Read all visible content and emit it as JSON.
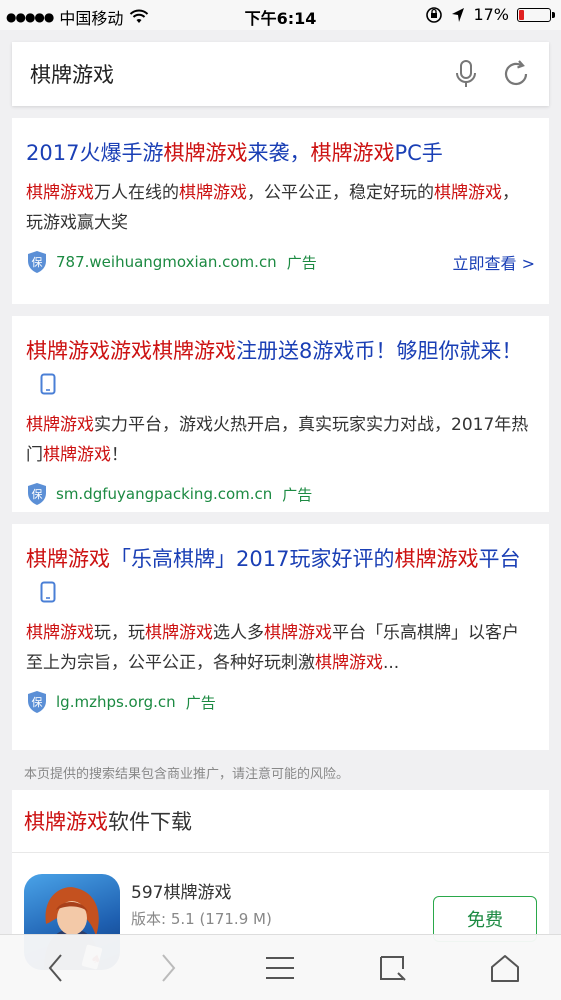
{
  "status_bar": {
    "carrier": "中国移动",
    "time": "下午6:14",
    "battery": "17%",
    "battery_level": 0.17
  },
  "search": {
    "query": "棋牌游戏"
  },
  "results": [
    {
      "title": [
        [
          "2017火爆手游",
          false
        ],
        [
          "棋牌游戏",
          true
        ],
        [
          "来袭，",
          false
        ],
        [
          "棋牌游戏",
          true
        ],
        [
          "PC手",
          false
        ]
      ],
      "desc": [
        [
          "棋牌游戏",
          true
        ],
        [
          "万人在线的",
          false
        ],
        [
          "棋牌游戏",
          true
        ],
        [
          "，公平公正，稳定好玩的",
          false
        ],
        [
          "棋牌游戏",
          true
        ],
        [
          "，玩游戏赢大奖",
          false
        ]
      ],
      "url": "787.weihuangmoxian.com.cn",
      "ad": "广告",
      "more": "立即查看 >"
    },
    {
      "title": [
        [
          "棋牌游戏游戏棋牌游戏",
          true
        ],
        [
          "注册送8游戏币！够胆你就来！",
          false
        ]
      ],
      "desc": [
        [
          "棋牌游戏",
          true
        ],
        [
          "实力平台，游戏火热开启，真实玩家实力对战，2017年热门",
          false
        ],
        [
          "棋牌游戏",
          true
        ],
        [
          "！",
          false
        ]
      ],
      "url": "sm.dgfuyangpacking.com.cn",
      "ad": "广告"
    },
    {
      "title": [
        [
          "棋牌游戏",
          true
        ],
        [
          "「乐高棋牌」2017玩家好评的",
          false
        ],
        [
          "棋牌游戏",
          true
        ],
        [
          "平台",
          false
        ]
      ],
      "desc": [
        [
          "棋牌游戏",
          true
        ],
        [
          "玩，玩",
          false
        ],
        [
          "棋牌游戏",
          true
        ],
        [
          "选人多",
          false
        ],
        [
          "棋牌游戏",
          true
        ],
        [
          "平台「乐高棋牌」以客户至上为宗旨，公平公正，各种好玩刺激",
          false
        ],
        [
          "棋牌游戏",
          true
        ],
        [
          "...",
          false
        ]
      ],
      "url": "lg.mzhps.org.cn",
      "ad": "广告"
    }
  ],
  "notice": "本页提供的搜索结果包含商业推广，请注意可能的风险。",
  "download": {
    "title_hl": "棋牌游戏",
    "title_rest": "软件下载",
    "app_name": "597棋牌游戏",
    "app_version": "版本: 5.1 (171.9 M)",
    "button": "免费"
  },
  "colors": {
    "title_blue": "#1a3fb5",
    "highlight_red": "#cc1111",
    "url_green": "#1c8a42"
  }
}
